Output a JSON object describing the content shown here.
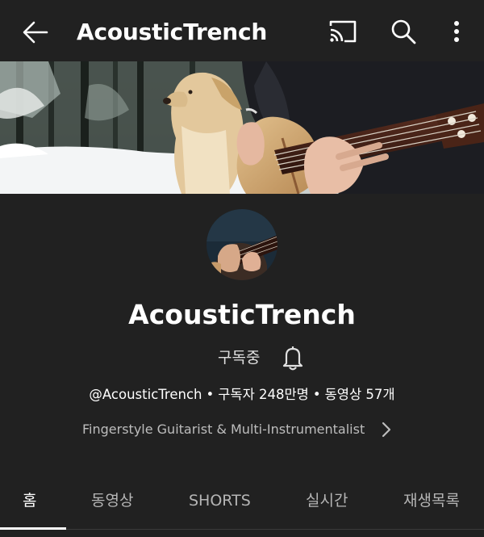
{
  "header": {
    "title": "AcousticTrench",
    "icons": [
      "back-arrow-icon",
      "cast-icon",
      "search-icon",
      "more-vert-icon"
    ]
  },
  "banner": {
    "description": "snowy forest, dog, acoustic guitar",
    "icon": "channel-banner-image"
  },
  "channel": {
    "name": "AcousticTrench",
    "subscribe_label": "구독중",
    "handle": "@AcousticTrench",
    "subscribers": "구독자 248만명",
    "videos": "동영상 57개",
    "separator": "•",
    "description": "Fingerstyle Guitarist & Multi-Instrumentalist"
  },
  "tabs": [
    {
      "label": "홈",
      "active": true
    },
    {
      "label": "동영상",
      "active": false
    },
    {
      "label": "SHORTS",
      "active": false
    },
    {
      "label": "실시간",
      "active": false
    },
    {
      "label": "재생목록",
      "active": false
    }
  ],
  "colors": {
    "background": "#212121",
    "text_primary": "#ffffff",
    "text_secondary": "#bdbdbd",
    "tab_inactive": "#b5b5b5"
  }
}
